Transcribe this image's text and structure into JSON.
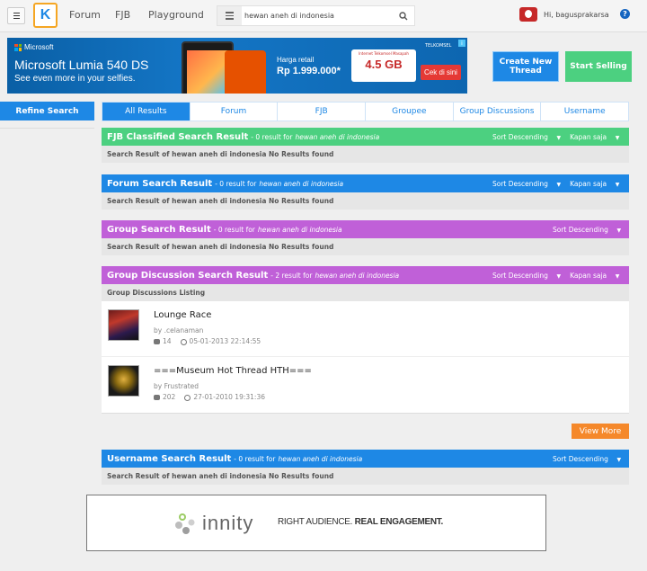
{
  "header": {
    "nav": [
      "Forum",
      "FJB",
      "Playground"
    ],
    "search": {
      "value": "hewan aneh di indonesia"
    },
    "user": {
      "greeting": "Hi, bagusprakarsa"
    },
    "help": "?"
  },
  "ad_top": {
    "brand": "Microsoft",
    "title": "Microsoft Lumia 540 DS",
    "subtitle": "See even more in your selfies.",
    "price_label": "Harga retail",
    "price": "Rp 1.999.000*",
    "gb_note": "Internet Telkomsel Masapah",
    "gb_value": "4.5 GB",
    "operator": "TELKOMSEL",
    "cta": "Cek di sini",
    "close": "i",
    "colors": {
      "bg": "#0d66b0"
    }
  },
  "actions": {
    "create_thread": "Create New Thread",
    "start_selling": "Start Selling"
  },
  "sidebar": {
    "refine": "Refine Search"
  },
  "tabs": [
    "All Results",
    "Forum",
    "FJB",
    "Groupee",
    "Group Discussions",
    "Username"
  ],
  "query": "hewan aneh di indonesia",
  "sections": {
    "fjb": {
      "title": "FJB Classified Search Result",
      "count": "- 0 result for",
      "sort": "Sort Descending",
      "time": "Kapan saja",
      "body": "Search Result of hewan aneh di indonesia No Results found"
    },
    "forum": {
      "title": "Forum Search Result",
      "count": "- 0 result for",
      "sort": "Sort Descending",
      "time": "Kapan saja",
      "body": "Search Result of hewan aneh di indonesia No Results found"
    },
    "group": {
      "title": "Group Search Result",
      "count": "- 0 result for",
      "sort": "Sort Descending",
      "body": "Search Result of hewan aneh di indonesia No Results found"
    },
    "group_discussion": {
      "title": "Group Discussion Search Result",
      "count": "- 2 result for",
      "sort": "Sort Descending",
      "time": "Kapan saja",
      "body": "Group Discussions Listing",
      "threads": [
        {
          "title": "Lounge Race",
          "by": "by .celanaman",
          "replies": "14",
          "date": "05-01-2013 22:14:55"
        },
        {
          "title": "===Museum Hot Thread HTH===",
          "by": "by Frustrated",
          "replies": "202",
          "date": "27-01-2010 19:31:36"
        }
      ],
      "view_more": "View More"
    },
    "username": {
      "title": "Username Search Result",
      "count": "- 0 result for",
      "sort": "Sort Descending",
      "body": "Search Result of hewan aneh di indonesia No Results found"
    }
  },
  "ad_bottom": {
    "brand": "innity",
    "tagline_a": "RIGHT AUDIENCE.",
    "tagline_b": "REAL ENGAGEMENT."
  }
}
